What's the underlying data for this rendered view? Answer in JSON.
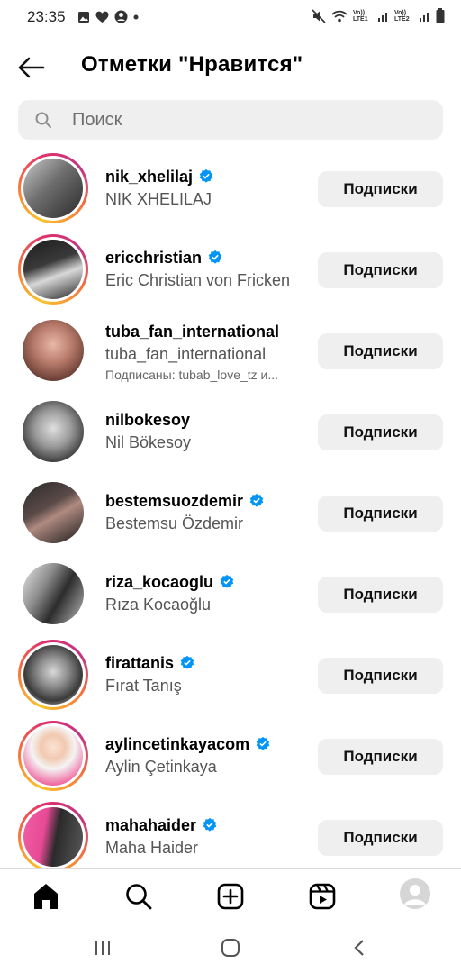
{
  "status_bar": {
    "time": "23:35",
    "network_1": "Vo)) LTE1",
    "network_2": "Vo)) LTE2"
  },
  "header": {
    "title": "Отметки \"Нравится\""
  },
  "search": {
    "placeholder": "Поиск"
  },
  "users": [
    {
      "username": "nik_xhelilaj",
      "full_name": "NIK XHELILAJ",
      "verified": true,
      "story_ring": true,
      "mutual": "",
      "button": "Подписки"
    },
    {
      "username": "ericchristian",
      "full_name": "Eric Christian von Fricken",
      "verified": true,
      "story_ring": true,
      "mutual": "",
      "button": "Подписки"
    },
    {
      "username": "tuba_fan_international",
      "full_name": "tuba_fan_international",
      "verified": false,
      "story_ring": false,
      "mutual": "Подписаны: tubab_love_tz и...",
      "button": "Подписки"
    },
    {
      "username": "nilbokesoy",
      "full_name": "Nil Bökesoy",
      "verified": false,
      "story_ring": false,
      "mutual": "",
      "button": "Подписки"
    },
    {
      "username": "bestemsuozdemir",
      "full_name": "Bestemsu Özdemir",
      "verified": true,
      "story_ring": false,
      "mutual": "",
      "button": "Подписки"
    },
    {
      "username": "riza_kocaoglu",
      "full_name": "Rıza Kocaoğlu",
      "verified": true,
      "story_ring": false,
      "mutual": "",
      "button": "Подписки"
    },
    {
      "username": "firattanis",
      "full_name": "Fırat Tanış",
      "verified": true,
      "story_ring": true,
      "mutual": "",
      "button": "Подписки"
    },
    {
      "username": "aylincetinkayacom",
      "full_name": "Aylin Çetinkaya",
      "verified": true,
      "story_ring": true,
      "mutual": "",
      "button": "Подписки"
    },
    {
      "username": "mahahaider",
      "full_name": "Maha Haider",
      "verified": true,
      "story_ring": true,
      "mutual": "",
      "button": "Подписки"
    }
  ],
  "colors": {
    "verified": "#0095f6",
    "button_bg": "#efefef"
  }
}
